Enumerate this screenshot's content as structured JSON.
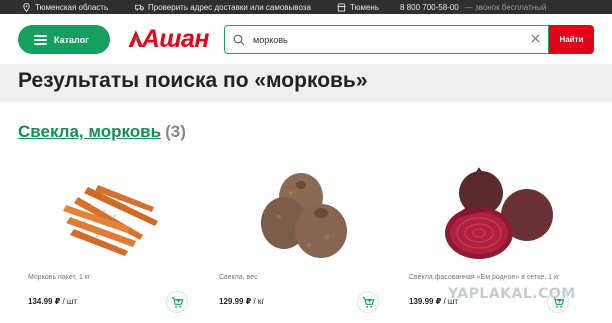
{
  "topbar": {
    "region": "Тюменская область",
    "delivery_check": "Проверить адрес доставки или самовывоза",
    "city": "Тюмень",
    "phone": "8 800 700-58-00",
    "phone_note": "— звонок бесплатный"
  },
  "header": {
    "catalog_label": "Каталог",
    "logo_text": "Ашан",
    "search_value": "морковь",
    "search_button": "Найти"
  },
  "results": {
    "title": "Результаты поиска по «морковь»"
  },
  "category": {
    "name": "Свекла, морковь",
    "count": "(3)"
  },
  "products": [
    {
      "name": "Морковь пакет, 1 кг",
      "price": "134.99 ₽",
      "unit": " / шт"
    },
    {
      "name": "Свекла, вес",
      "price": "129.99 ₽",
      "unit": " / кг"
    },
    {
      "name": "Свекла фасованная «Ем родное» в сетке, 1 кг",
      "price": "139.99 ₽",
      "unit": " / шт"
    }
  ],
  "watermark": "YAPLAKAL.COM",
  "colors": {
    "brand_green": "#159e5d",
    "brand_red": "#e2001a",
    "topbar": "#2f2f2f"
  }
}
